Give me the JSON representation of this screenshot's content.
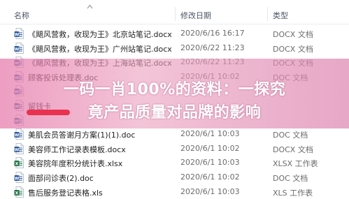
{
  "header": {
    "name_label": "名称",
    "date_label": "修改日期",
    "type_label": "类型"
  },
  "files": [
    {
      "name": "《飓风营救，收现为王》北京站笔记.docx",
      "date": "2020/6/16 16:17",
      "type": "DOCX 文档",
      "icon": "word-doc-icon"
    },
    {
      "name": "《飓风营救，收现为王》广州站笔记.docx",
      "date": "2020/6/22 11:23",
      "type": "DOCX 文档",
      "icon": "word-doc-icon"
    },
    {
      "name": "《飓风营救，收现为王》上海站笔记.docx",
      "date": "2020/6/22 11:23",
      "type": "DOCX 文档",
      "icon": "word-doc-icon"
    },
    {
      "name": "顾客投诉处理表.doc",
      "date": "2020/6/1 10:02",
      "type": "DOC 文档",
      "icon": "word-doc-icon"
    },
    {
      "name": "",
      "date": "",
      "type": "",
      "icon": "word-doc-icon"
    },
    {
      "name": "留钱卡",
      "date": "",
      "type": "",
      "icon": "word-doc-icon"
    },
    {
      "name": "",
      "date": "",
      "type": "",
      "icon": "word-doc-icon"
    },
    {
      "name": "美肌会员答谢月方案(1)(1).doc",
      "date": "2020/6/1 10:03",
      "type": "DOC 文档",
      "icon": "word-doc-icon"
    },
    {
      "name": "美容师工作记录表模板.docx",
      "date": "2020/6/1 10:02",
      "type": "DOCX 文档",
      "icon": "word-doc-icon"
    },
    {
      "name": "美容院年度积分统计表.xlsx",
      "date": "2020/6/1 10:03",
      "type": "XLSX 工作表",
      "icon": "excel-sheet-icon"
    },
    {
      "name": "面部问诊表(2).doc",
      "date": "2020/6/1 10:02",
      "type": "DOC 文档",
      "icon": "word-doc-icon"
    },
    {
      "name": "售后服务登记表格.xls",
      "date": "2020/6/1 10:03",
      "type": "XLS 工作表",
      "icon": "excel-sheet-icon"
    }
  ],
  "overlay": {
    "line1": "一码一肖100%的资料：一探究",
    "line2": "竟产品质量对品牌的影响"
  },
  "colors": {
    "word_icon": "#2b579a",
    "excel_icon": "#1e7145",
    "overlay_pink": "#e678aa",
    "red_bar": "#e8324f"
  }
}
